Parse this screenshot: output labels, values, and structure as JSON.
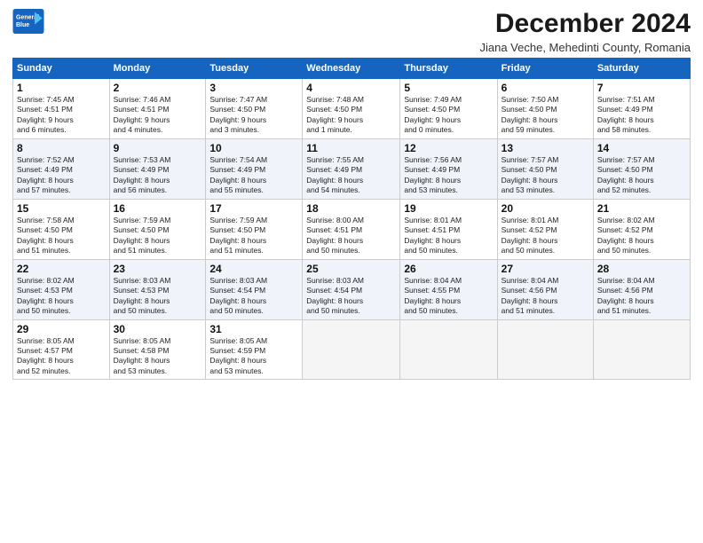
{
  "logo": {
    "line1": "General",
    "line2": "Blue"
  },
  "title": "December 2024",
  "subtitle": "Jiana Veche, Mehedinti County, Romania",
  "headers": [
    "Sunday",
    "Monday",
    "Tuesday",
    "Wednesday",
    "Thursday",
    "Friday",
    "Saturday"
  ],
  "weeks": [
    [
      {
        "day": "1",
        "detail": "Sunrise: 7:45 AM\nSunset: 4:51 PM\nDaylight: 9 hours\nand 6 minutes."
      },
      {
        "day": "2",
        "detail": "Sunrise: 7:46 AM\nSunset: 4:51 PM\nDaylight: 9 hours\nand 4 minutes."
      },
      {
        "day": "3",
        "detail": "Sunrise: 7:47 AM\nSunset: 4:50 PM\nDaylight: 9 hours\nand 3 minutes."
      },
      {
        "day": "4",
        "detail": "Sunrise: 7:48 AM\nSunset: 4:50 PM\nDaylight: 9 hours\nand 1 minute."
      },
      {
        "day": "5",
        "detail": "Sunrise: 7:49 AM\nSunset: 4:50 PM\nDaylight: 9 hours\nand 0 minutes."
      },
      {
        "day": "6",
        "detail": "Sunrise: 7:50 AM\nSunset: 4:50 PM\nDaylight: 8 hours\nand 59 minutes."
      },
      {
        "day": "7",
        "detail": "Sunrise: 7:51 AM\nSunset: 4:49 PM\nDaylight: 8 hours\nand 58 minutes."
      }
    ],
    [
      {
        "day": "8",
        "detail": "Sunrise: 7:52 AM\nSunset: 4:49 PM\nDaylight: 8 hours\nand 57 minutes."
      },
      {
        "day": "9",
        "detail": "Sunrise: 7:53 AM\nSunset: 4:49 PM\nDaylight: 8 hours\nand 56 minutes."
      },
      {
        "day": "10",
        "detail": "Sunrise: 7:54 AM\nSunset: 4:49 PM\nDaylight: 8 hours\nand 55 minutes."
      },
      {
        "day": "11",
        "detail": "Sunrise: 7:55 AM\nSunset: 4:49 PM\nDaylight: 8 hours\nand 54 minutes."
      },
      {
        "day": "12",
        "detail": "Sunrise: 7:56 AM\nSunset: 4:49 PM\nDaylight: 8 hours\nand 53 minutes."
      },
      {
        "day": "13",
        "detail": "Sunrise: 7:57 AM\nSunset: 4:50 PM\nDaylight: 8 hours\nand 53 minutes."
      },
      {
        "day": "14",
        "detail": "Sunrise: 7:57 AM\nSunset: 4:50 PM\nDaylight: 8 hours\nand 52 minutes."
      }
    ],
    [
      {
        "day": "15",
        "detail": "Sunrise: 7:58 AM\nSunset: 4:50 PM\nDaylight: 8 hours\nand 51 minutes."
      },
      {
        "day": "16",
        "detail": "Sunrise: 7:59 AM\nSunset: 4:50 PM\nDaylight: 8 hours\nand 51 minutes."
      },
      {
        "day": "17",
        "detail": "Sunrise: 7:59 AM\nSunset: 4:50 PM\nDaylight: 8 hours\nand 51 minutes."
      },
      {
        "day": "18",
        "detail": "Sunrise: 8:00 AM\nSunset: 4:51 PM\nDaylight: 8 hours\nand 50 minutes."
      },
      {
        "day": "19",
        "detail": "Sunrise: 8:01 AM\nSunset: 4:51 PM\nDaylight: 8 hours\nand 50 minutes."
      },
      {
        "day": "20",
        "detail": "Sunrise: 8:01 AM\nSunset: 4:52 PM\nDaylight: 8 hours\nand 50 minutes."
      },
      {
        "day": "21",
        "detail": "Sunrise: 8:02 AM\nSunset: 4:52 PM\nDaylight: 8 hours\nand 50 minutes."
      }
    ],
    [
      {
        "day": "22",
        "detail": "Sunrise: 8:02 AM\nSunset: 4:53 PM\nDaylight: 8 hours\nand 50 minutes."
      },
      {
        "day": "23",
        "detail": "Sunrise: 8:03 AM\nSunset: 4:53 PM\nDaylight: 8 hours\nand 50 minutes."
      },
      {
        "day": "24",
        "detail": "Sunrise: 8:03 AM\nSunset: 4:54 PM\nDaylight: 8 hours\nand 50 minutes."
      },
      {
        "day": "25",
        "detail": "Sunrise: 8:03 AM\nSunset: 4:54 PM\nDaylight: 8 hours\nand 50 minutes."
      },
      {
        "day": "26",
        "detail": "Sunrise: 8:04 AM\nSunset: 4:55 PM\nDaylight: 8 hours\nand 50 minutes."
      },
      {
        "day": "27",
        "detail": "Sunrise: 8:04 AM\nSunset: 4:56 PM\nDaylight: 8 hours\nand 51 minutes."
      },
      {
        "day": "28",
        "detail": "Sunrise: 8:04 AM\nSunset: 4:56 PM\nDaylight: 8 hours\nand 51 minutes."
      }
    ],
    [
      {
        "day": "29",
        "detail": "Sunrise: 8:05 AM\nSunset: 4:57 PM\nDaylight: 8 hours\nand 52 minutes."
      },
      {
        "day": "30",
        "detail": "Sunrise: 8:05 AM\nSunset: 4:58 PM\nDaylight: 8 hours\nand 53 minutes."
      },
      {
        "day": "31",
        "detail": "Sunrise: 8:05 AM\nSunset: 4:59 PM\nDaylight: 8 hours\nand 53 minutes."
      },
      {
        "day": "",
        "detail": ""
      },
      {
        "day": "",
        "detail": ""
      },
      {
        "day": "",
        "detail": ""
      },
      {
        "day": "",
        "detail": ""
      }
    ]
  ]
}
